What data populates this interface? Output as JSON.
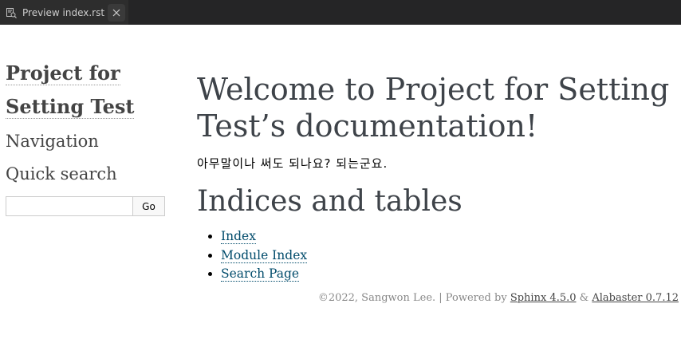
{
  "tab": {
    "label": "Preview index.rst",
    "icon": "preview-icon",
    "close_icon": "close-icon"
  },
  "sidebar": {
    "logo_line1": "Project for",
    "logo_line2": "Setting Test",
    "navigation_heading": "Navigation",
    "search_heading": "Quick search",
    "search_value": "",
    "search_button": "Go"
  },
  "main": {
    "title_line1": "Welcome to Project for Setting",
    "title_line2": "Test’s documentation!",
    "body_text": "아무말이나 써도 되나요? 되는군요.",
    "indices_heading": "Indices and tables",
    "indices": [
      "Index",
      "Module Index",
      "Search Page"
    ]
  },
  "footer": {
    "copyright": "©2022, Sangwon Lee.",
    "separator": " | Powered by ",
    "sphinx_link": "Sphinx 4.5.0",
    "ampersand": " & ",
    "alabaster_link": "Alabaster 0.7.12"
  },
  "colors": {
    "tabbar_bg": "#252526",
    "link": "#004b6b",
    "heading": "#3e4349"
  }
}
